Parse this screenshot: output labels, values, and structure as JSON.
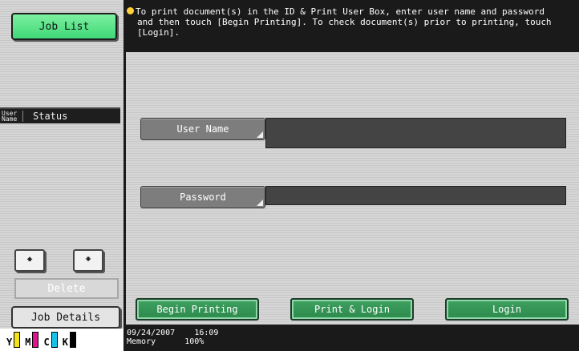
{
  "left": {
    "job_list_button": "Job List",
    "header_user": "User Name",
    "header_status": "Status",
    "up_icon": "up-arrow-icon",
    "down_icon": "down-arrow-icon",
    "delete_button": "Delete",
    "job_details_button": "Job Details",
    "toner": [
      {
        "letter": "Y",
        "color": "#f5e21a"
      },
      {
        "letter": "M",
        "color": "#e0148c"
      },
      {
        "letter": "C",
        "color": "#18c0e8"
      },
      {
        "letter": "K",
        "color": "#000000"
      }
    ]
  },
  "message": {
    "line1": "To print document(s) in the ID & Print User Box, enter user name and password",
    "line2": "and then touch [Begin Printing]. To check document(s) prior to printing, touch",
    "line3": "[Login]."
  },
  "form": {
    "user_name_label": "User Name",
    "user_name_value": "",
    "password_label": "Password",
    "password_value": ""
  },
  "actions": {
    "begin_printing": "Begin Printing",
    "print_login": "Print & Login",
    "login": "Login"
  },
  "status": {
    "date": "09/24/2007",
    "time": "16:09",
    "memory_label": "Memory",
    "memory_value": "100%"
  },
  "colors": {
    "accent_green": "#3fd878",
    "action_green": "#2c8a4c",
    "bulb_yellow": "#ffd23a"
  }
}
